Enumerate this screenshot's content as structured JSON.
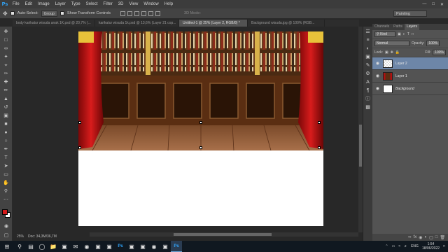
{
  "menubar": {
    "logo": "Ps",
    "items": [
      "File",
      "Edit",
      "Image",
      "Layer",
      "Type",
      "Select",
      "Filter",
      "3D",
      "View",
      "Window",
      "Help"
    ]
  },
  "options": {
    "auto_select_label": "Auto-Select:",
    "auto_select_value": "Group",
    "transform_label": "Show Transform Controls",
    "mode_3d": "3D Mode:",
    "workspace": "Painting"
  },
  "tabs": [
    {
      "label": "body karikatur wisuda anak 1K.psd @ 20,7% (...",
      "active": false
    },
    {
      "label": "karikatur wisuda 1k.psd @ 13,6% (Layer 21 cop...",
      "active": false
    },
    {
      "label": "Untitled-1 @ 25% (Layer 2, RGB/8) *",
      "active": true
    },
    {
      "label": "Background wisuda.jpg @ 100% (RGB...",
      "active": false
    }
  ],
  "status": {
    "zoom": "25%",
    "doc": "Doc: 34,3M/36,7M"
  },
  "panel": {
    "tabs": [
      "Channels",
      "Paths",
      "Layers"
    ],
    "kind_label": "Kind",
    "blend_mode": "Normal",
    "opacity_label": "Opacity:",
    "opacity_value": "100%",
    "lock_label": "Lock:",
    "fill_label": "Fill:",
    "fill_value": "100%",
    "layers": [
      {
        "name": "Layer 2",
        "selected": true
      },
      {
        "name": "Layer 1",
        "selected": false
      },
      {
        "name": "Background",
        "selected": false,
        "italic": true
      }
    ]
  },
  "taskbar": {
    "time": "1:54",
    "date": "18/06/2022",
    "lang": "ENG"
  },
  "colors": {
    "foreground": "#d61a1a",
    "background": "#ffffff",
    "accent": "#31a8ff"
  }
}
